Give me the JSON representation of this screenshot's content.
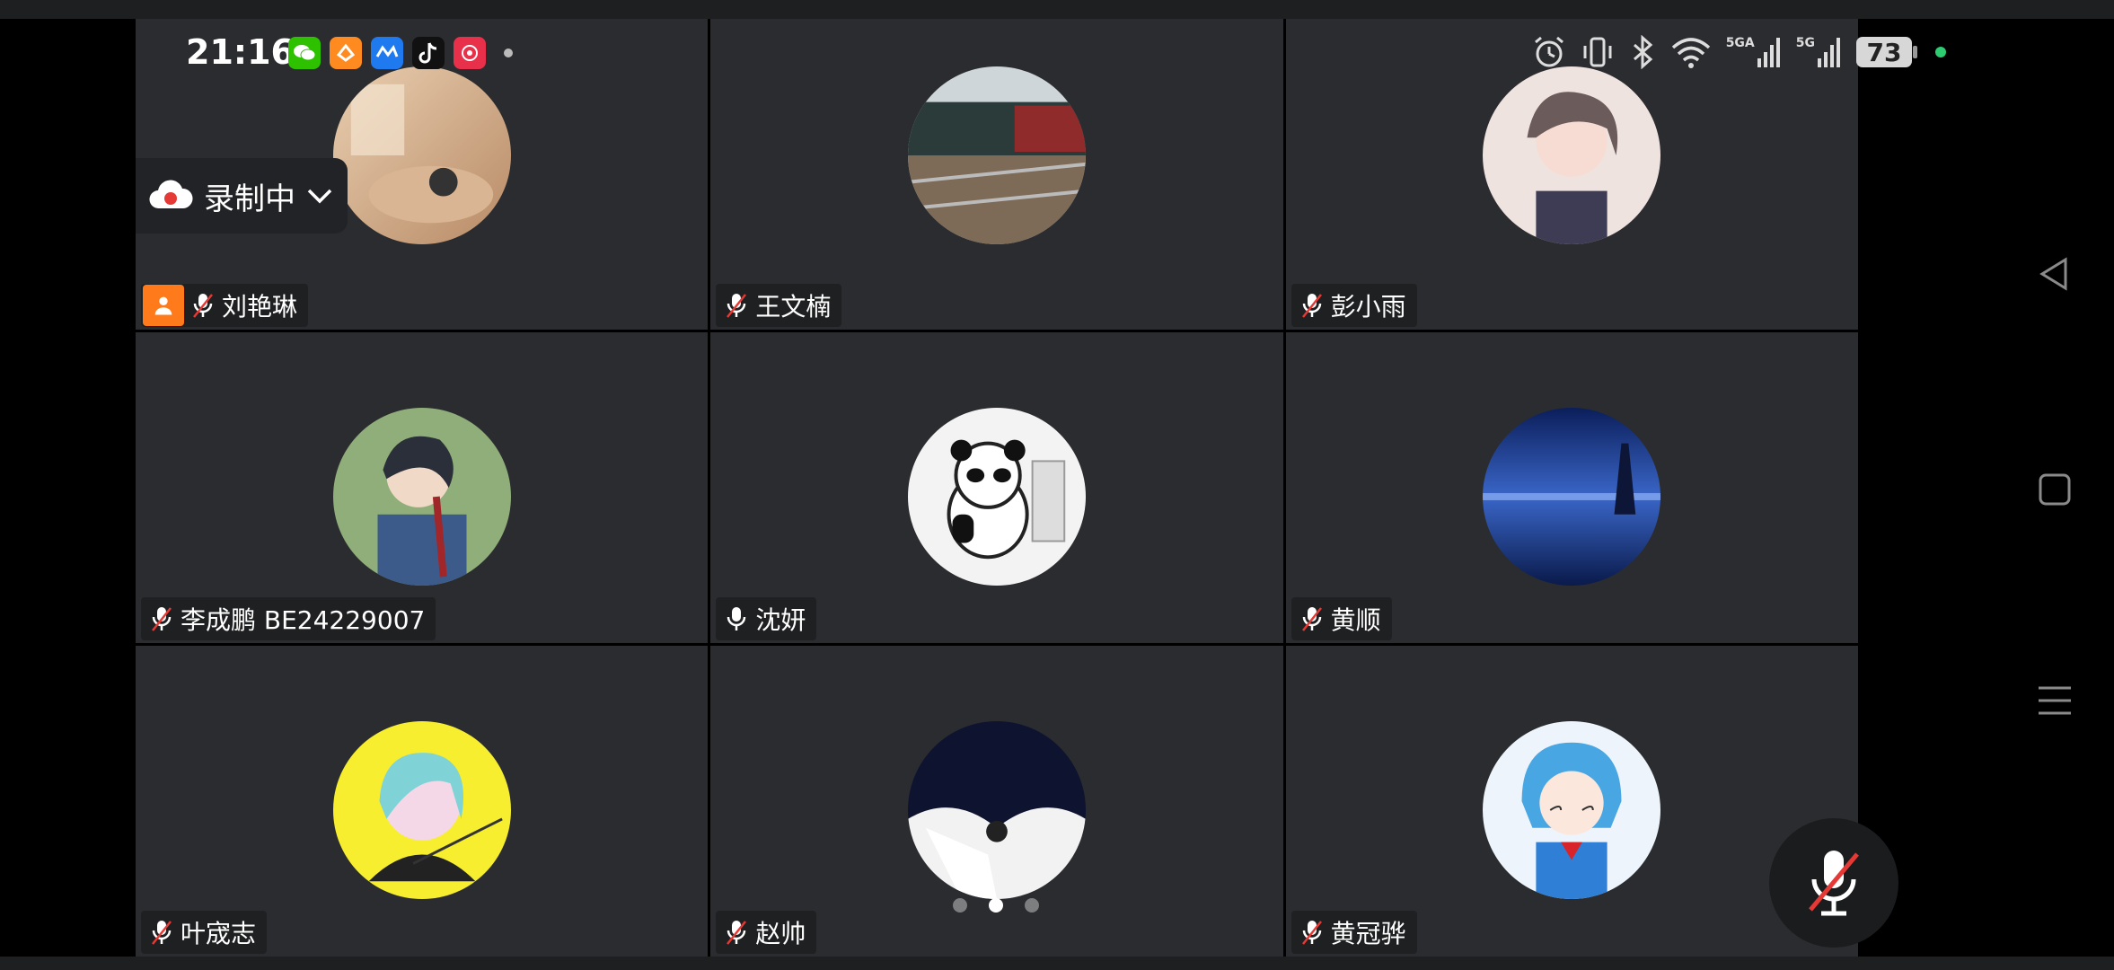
{
  "status_bar": {
    "time": "21:16",
    "battery_level": "73",
    "signal_1_label": "5GA",
    "signal_2_label": "5G",
    "app_icons": [
      "wechat-icon",
      "orange-app-icon",
      "lark-icon",
      "tiktok-icon",
      "taobao-icon"
    ]
  },
  "recording": {
    "label": "录制中"
  },
  "participants": [
    {
      "name": "刘艳琳",
      "mic": "muted",
      "host": true
    },
    {
      "name": "王文楠",
      "mic": "muted"
    },
    {
      "name": "彭小雨",
      "mic": "muted"
    },
    {
      "name": "李成鹏 BE24229007",
      "mic": "muted"
    },
    {
      "name": "沈妍",
      "mic": "on"
    },
    {
      "name": "黄顺",
      "mic": "muted"
    },
    {
      "name": "叶宬志",
      "mic": "muted"
    },
    {
      "name": "赵帅",
      "mic": "muted"
    },
    {
      "name": "黄冠骅",
      "mic": "muted"
    }
  ],
  "pager": {
    "pages": 3,
    "active": 2
  },
  "colors": {
    "tile_bg": "#2b2c2f",
    "host_badge": "#ff7a1a",
    "mute_red": "#e53935",
    "recording_red": "#e53935"
  }
}
